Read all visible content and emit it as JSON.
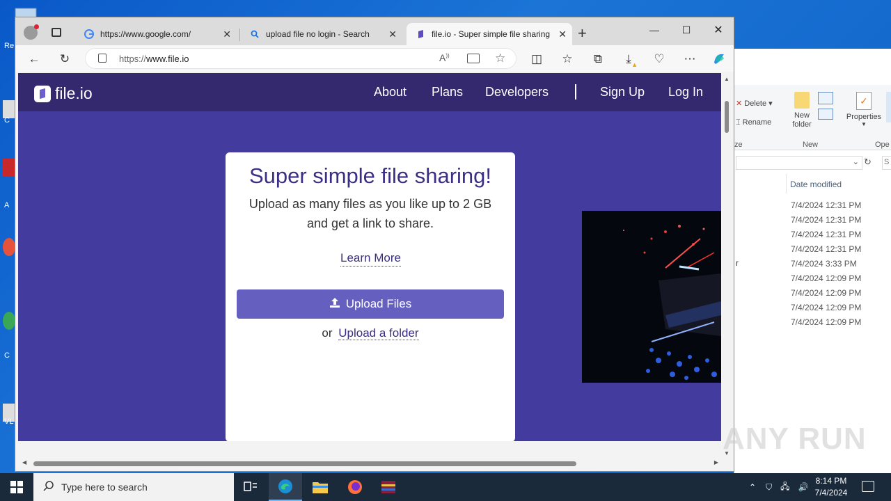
{
  "desktop": {
    "labels": [
      "Re",
      "C",
      "A",
      "C",
      "VL"
    ]
  },
  "explorer": {
    "ribbon": {
      "delete": "Delete",
      "rename": "Rename",
      "new_folder": "New\nfolder",
      "properties": "Properties",
      "group_new": "New",
      "group_open": "Ope",
      "group_organize": "ze"
    },
    "column_date": "Date modified",
    "dates": [
      "7/4/2024 12:31 PM",
      "7/4/2024 12:31 PM",
      "7/4/2024 12:31 PM",
      "7/4/2024 12:31 PM",
      "7/4/2024 3:33 PM",
      "7/4/2024 12:09 PM",
      "7/4/2024 12:09 PM",
      "7/4/2024 12:09 PM",
      "7/4/2024 12:09 PM"
    ],
    "row_fragment": "r",
    "search_fragment": "S"
  },
  "browser": {
    "tabs": [
      {
        "title": "https://www.google.com/",
        "icon": "google-icon"
      },
      {
        "title": "upload file no login - Search",
        "icon": "search-icon"
      },
      {
        "title": "file.io - Super simple file sharing",
        "icon": "fileio-icon",
        "active": true
      }
    ],
    "url": "https://www.file.io",
    "url_prefix": "https://",
    "url_host": "www.file.io"
  },
  "site": {
    "logo": "file.io",
    "nav": [
      "About",
      "Plans",
      "Developers",
      "Sign Up",
      "Log In"
    ],
    "headline": "Super simple file sharing!",
    "subline1": "Upload as many files as you like up to 2 GB",
    "subline2": "and get a link to share.",
    "learn_more": "Learn More",
    "upload_files": "Upload Files",
    "or": "or",
    "upload_folder": "Upload a folder"
  },
  "taskbar": {
    "search_placeholder": "Type here to search",
    "time": "8:14 PM",
    "date": "7/4/2024"
  },
  "watermark": "ANY RUN",
  "colors": {
    "site_nav": "#34296f",
    "site_bg": "#433b9d",
    "accent_button": "#6560c0",
    "headline": "#3a2f85"
  }
}
